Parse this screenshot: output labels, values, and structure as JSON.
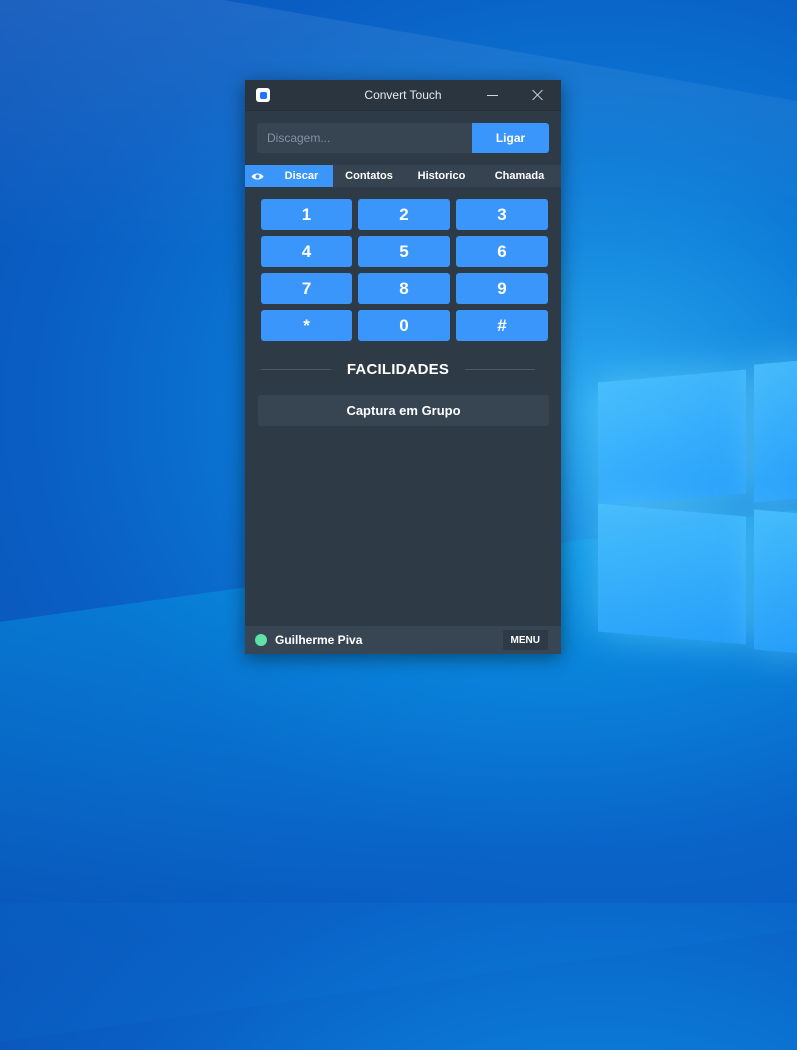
{
  "window": {
    "title": "Convert Touch"
  },
  "dial": {
    "placeholder": "Discagem...",
    "call_label": "Ligar"
  },
  "tabs": [
    {
      "label": "Discar",
      "active": true
    },
    {
      "label": "Contatos",
      "active": false
    },
    {
      "label": "Historico",
      "active": false
    },
    {
      "label": "Chamada",
      "active": false
    }
  ],
  "keypad": [
    "1",
    "2",
    "3",
    "4",
    "5",
    "6",
    "7",
    "8",
    "9",
    "*",
    "0",
    "#"
  ],
  "facilities": {
    "title": "FACILIDADES",
    "items": [
      "Captura em Grupo"
    ]
  },
  "footer": {
    "user_name": "Guilherme Piva",
    "status_color": "#5ee2a8",
    "menu_label": "MENU"
  },
  "colors": {
    "accent": "#3a96fb",
    "app_bg": "#2e3a46"
  }
}
